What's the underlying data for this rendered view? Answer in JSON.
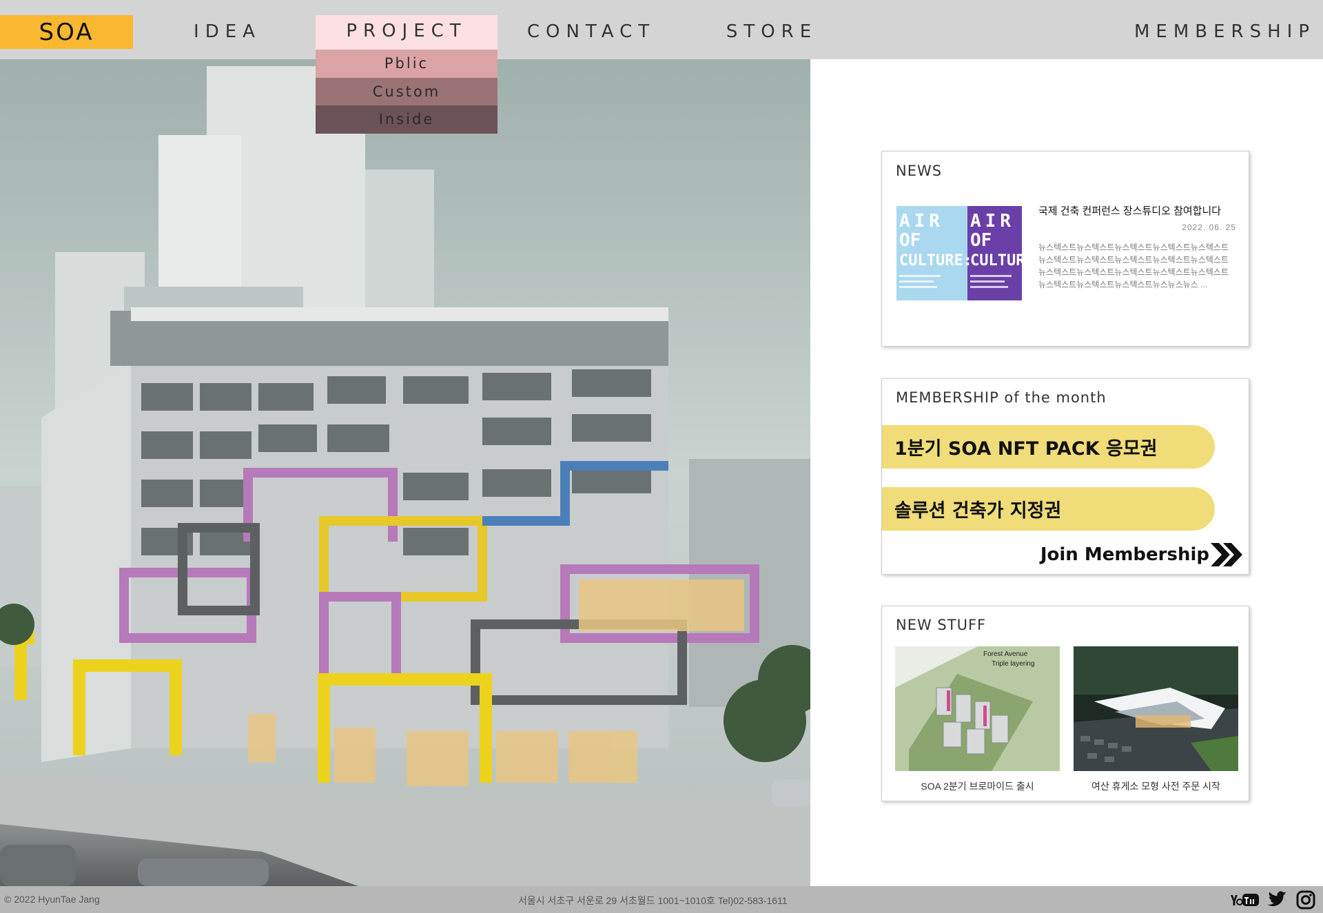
{
  "header": {
    "logo": "SOA",
    "nav": {
      "idea": "IDEA",
      "project": "PROJECT",
      "contact": "CONTACT",
      "store": "STORE",
      "membership": "MEMBERSHIP"
    },
    "project_dropdown": [
      "Pblic",
      "Custom",
      "Inside"
    ]
  },
  "news": {
    "title": "NEWS",
    "thumb_text": [
      "AIR",
      "OF",
      "CULTURE:"
    ],
    "headline": "국제 건축 컨퍼런스 장스튜디오 참여합니다",
    "date": "2022. 06. 25",
    "body": "뉴스텍스트뉴스텍스트뉴스텍스트뉴스텍스트뉴스텍스트뉴스텍스트뉴스텍스트뉴스텍스트뉴스텍스트뉴스텍스트뉴스텍스트뉴스텍스트뉴스텍스트뉴스텍스트뉴스텍스트뉴스텍스트뉴스텍스트뉴스텍스트뉴스뉴스뉴스 ..."
  },
  "membership": {
    "title": "MEMBERSHIP of the month",
    "items": [
      "1분기 SOA NFT PACK 응모권",
      "솔루션 건축가 지정권"
    ],
    "join_label": "Join Membership"
  },
  "new_stuff": {
    "title": "NEW STUFF",
    "image_1_text": [
      "Forest Avenue",
      "Triple layering"
    ],
    "items": [
      {
        "caption": "SOA 2분기 브로마이드 출시"
      },
      {
        "caption": "여산 휴게소 모형 사전 주문 시작"
      }
    ]
  },
  "footer": {
    "copyright": "© 2022 HyunTae Jang",
    "address": "서울시 서초구 서운로 29 서초월드 1001~1010호 Tel)02-583-1611",
    "social": [
      "youtube-icon",
      "twitter-icon",
      "instagram-icon"
    ]
  },
  "colors": {
    "logo_bg": "#f9b82f",
    "header_bg": "#d4d4d4",
    "project_active_bg": "#fde0e3",
    "pill_bg": "#f0dc78",
    "footer_bg": "#b7b7b7"
  }
}
